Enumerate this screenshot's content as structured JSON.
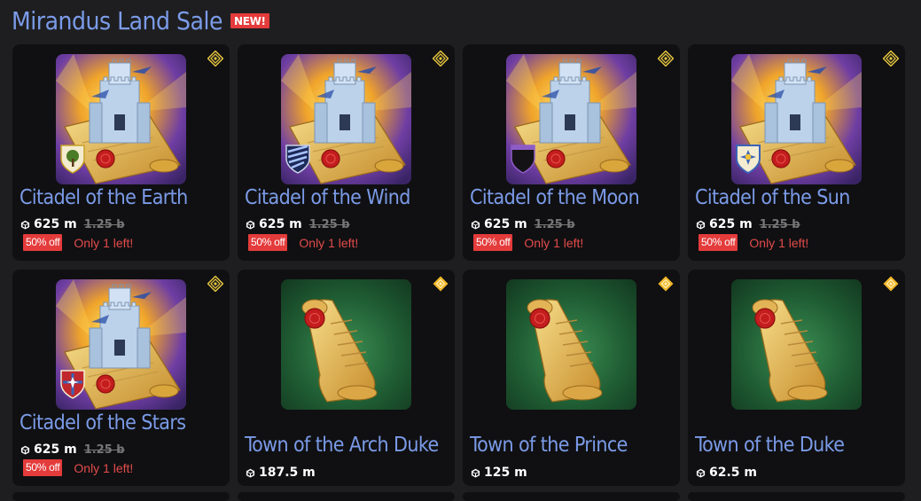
{
  "header": {
    "title": "Mirandus Land Sale",
    "badge": "NEW!"
  },
  "currency_icon": "cube-icon",
  "colors": {
    "accent": "#7b9be8",
    "sale_red": "#e43b3b",
    "card_bg": "#101012",
    "page_bg": "#1e1e20",
    "rarity_legendary": "#e9c73c",
    "rarity_mythic": "#f3b728"
  },
  "items": [
    {
      "name": "Citadel of the Earth",
      "price": "625 m",
      "old_price": "1.25 b",
      "discount": "50% off",
      "stock": "Only 1 left!",
      "kind": "citadel",
      "emblem": "tree-shield",
      "rarity_icon": "legendary-diamond-icon"
    },
    {
      "name": "Citadel of the Wind",
      "price": "625 m",
      "old_price": "1.25 b",
      "discount": "50% off",
      "stock": "Only 1 left!",
      "kind": "citadel",
      "emblem": "wind-shield",
      "rarity_icon": "legendary-diamond-icon"
    },
    {
      "name": "Citadel of the Moon",
      "price": "625 m",
      "old_price": "1.25 b",
      "discount": "50% off",
      "stock": "Only 1 left!",
      "kind": "citadel",
      "emblem": "moon-shield",
      "rarity_icon": "legendary-diamond-icon"
    },
    {
      "name": "Citadel of the Sun",
      "price": "625 m",
      "old_price": "1.25 b",
      "discount": "50% off",
      "stock": "Only 1 left!",
      "kind": "citadel",
      "emblem": "sun-shield",
      "rarity_icon": "legendary-diamond-icon"
    },
    {
      "name": "Citadel of the Stars",
      "price": "625 m",
      "old_price": "1.25 b",
      "discount": "50% off",
      "stock": "Only 1 left!",
      "kind": "citadel",
      "emblem": "star-shield",
      "rarity_icon": "legendary-diamond-icon"
    },
    {
      "name": "Town of the Arch Duke",
      "price": "187.5 m",
      "kind": "town",
      "rarity_icon": "mythic-diamond-icon"
    },
    {
      "name": "Town of the Prince",
      "price": "125 m",
      "kind": "town",
      "rarity_icon": "mythic-diamond-icon"
    },
    {
      "name": "Town of the Duke",
      "price": "62.5 m",
      "kind": "town",
      "rarity_icon": "mythic-diamond-icon"
    }
  ]
}
